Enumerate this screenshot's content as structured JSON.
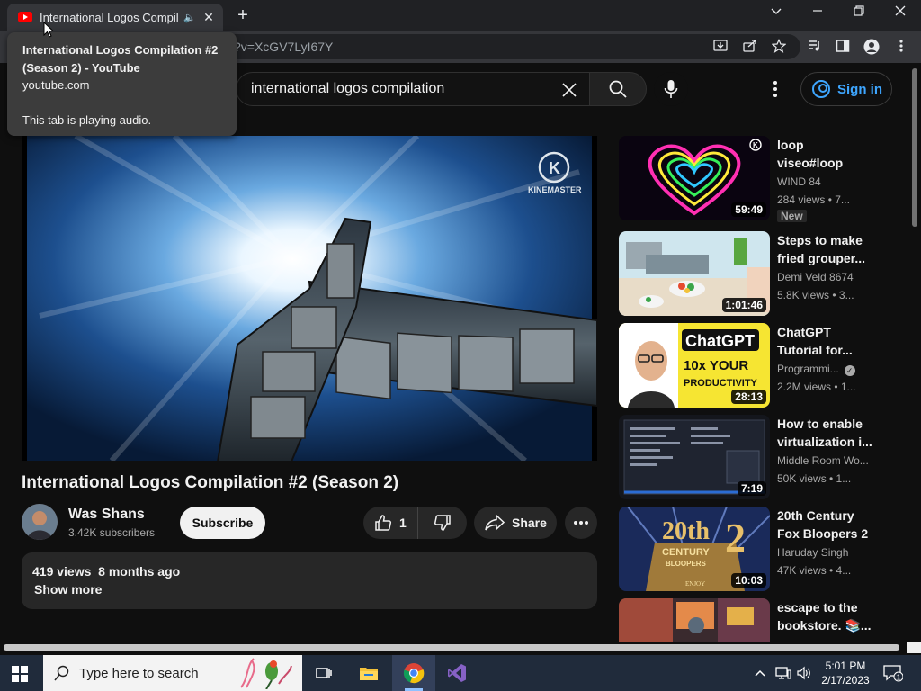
{
  "browser": {
    "tab_title": "International Logos Compilation #2 (Season 2) - YouTube",
    "tab_title_short": "International Logos Compila",
    "address": "?v=XcGV7LyI67Y",
    "hovercard": {
      "title": "International Logos Compilation #2 (Season 2) - YouTube",
      "domain": "youtube.com",
      "audio": "This tab is playing audio."
    },
    "icons": [
      "new-tab-icon",
      "chevron-down-icon",
      "minimize-icon",
      "restore-icon",
      "close-icon",
      "install-icon",
      "share-icon",
      "star-icon",
      "media-icon",
      "side-panel-icon",
      "profile-icon",
      "menu-icon"
    ]
  },
  "masthead": {
    "search_query": "international logos compilation",
    "signin_label": "Sign in",
    "accent": "#3ea6ff"
  },
  "video": {
    "title": "International Logos Compilation #2 (Season 2)",
    "watermark": "KINEMASTER",
    "channel_name": "Was Shans",
    "subscribers": "3.42K subscribers",
    "subscribe_label": "Subscribe",
    "likes": "1",
    "share_label": "Share",
    "views": "419 views",
    "age": "8 months ago",
    "show_more": "Show more"
  },
  "recommendations": [
    {
      "title": "loop\nviseo#loop",
      "channel": "WIND 84",
      "meta": "284 views  •  7...",
      "duration": "59:49",
      "badge": "New"
    },
    {
      "title": "Steps to make fried grouper...",
      "channel": "Demi Veld 8674",
      "meta": "5.8K views  •  3...",
      "duration": "1:01:46"
    },
    {
      "title": "ChatGPT Tutorial for...",
      "channel": "Programmi...",
      "meta": "2.2M views  •  1...",
      "duration": "28:13",
      "thumb_text": [
        "ChatGPT",
        "10x YOUR",
        "PRODUCTIVITY"
      ],
      "verified": true
    },
    {
      "title": "How to enable virtualization i...",
      "channel": "Middle Room Wo...",
      "meta": "50K views  •  1...",
      "duration": "7:19"
    },
    {
      "title": "20th Century Fox Bloopers 2",
      "channel": "Haruday Singh",
      "meta": "47K views  •  4...",
      "duration": "10:03",
      "thumb_text": [
        "20th",
        "2",
        "CENTURY",
        "BLOOPERS",
        "ENJOY"
      ]
    },
    {
      "title": "escape to the bookstore. 📚...",
      "channel": "",
      "meta": "",
      "duration": ""
    }
  ],
  "taskbar": {
    "search_placeholder": "Type here to search",
    "time": "5:01 PM",
    "date": "2/17/2023",
    "notification_count": "1"
  }
}
